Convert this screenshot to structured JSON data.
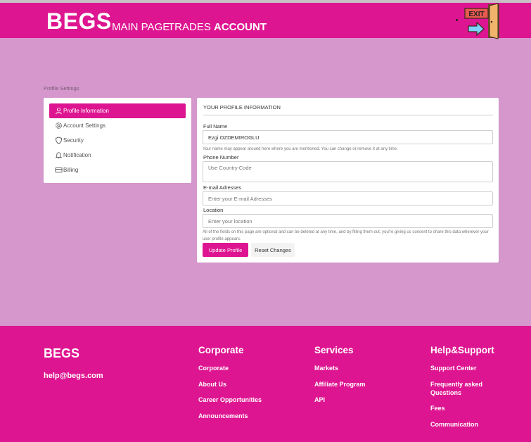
{
  "header": {
    "brand": "BEGS",
    "nav": [
      "MAIN PAGE",
      "TRADES",
      "ACCOUNT"
    ],
    "exit_label": "EXIT"
  },
  "breadcrumb": "Profile Settings",
  "sidebar": {
    "items": [
      {
        "label": "Profile Information",
        "icon": "user-icon",
        "active": true
      },
      {
        "label": "Account Settings",
        "icon": "gear-icon",
        "active": false
      },
      {
        "label": "Security",
        "icon": "shield-icon",
        "active": false
      },
      {
        "label": "Notification",
        "icon": "bell-icon",
        "active": false
      },
      {
        "label": "Billing",
        "icon": "credit-card-icon",
        "active": false
      }
    ]
  },
  "profile": {
    "title": "YOUR PROFILE INFORMATION",
    "full_name_label": "Full Name",
    "full_name_value": "Ezgi OZDEMIROGLU",
    "full_name_help": "Your name may appear around here where you are mentioned. You can change or remove it at any time.",
    "phone_label": "Phone Number",
    "phone_placeholder": "Use Country Code",
    "email_label": "E-mail Adresses",
    "email_placeholder": "Enter your E-mail Adresses",
    "location_label": "Location",
    "location_placeholder": "Enter your location",
    "consent_note": "All of the fields on this page are optional and can be deleted at any time, and by filling them out, you're giving us consent to share this data wherever your user profile appears.",
    "update_button": "Update Profile",
    "reset_button": "Reset Changes"
  },
  "footer": {
    "brand": "BEGS",
    "email": "help@begs.com",
    "columns": [
      {
        "title": "Corporate",
        "links": [
          "Corporate",
          "About Us",
          "Career Opportunities",
          "Announcements"
        ]
      },
      {
        "title": "Services",
        "links": [
          "Markets",
          "Affiliate Program",
          "API"
        ]
      },
      {
        "title": "Help&Support",
        "links": [
          "Support Center",
          "Frequently asked Questions",
          "Fees",
          "Communication"
        ]
      }
    ]
  },
  "colors": {
    "accent": "#de1591",
    "background": "#d597cc"
  }
}
